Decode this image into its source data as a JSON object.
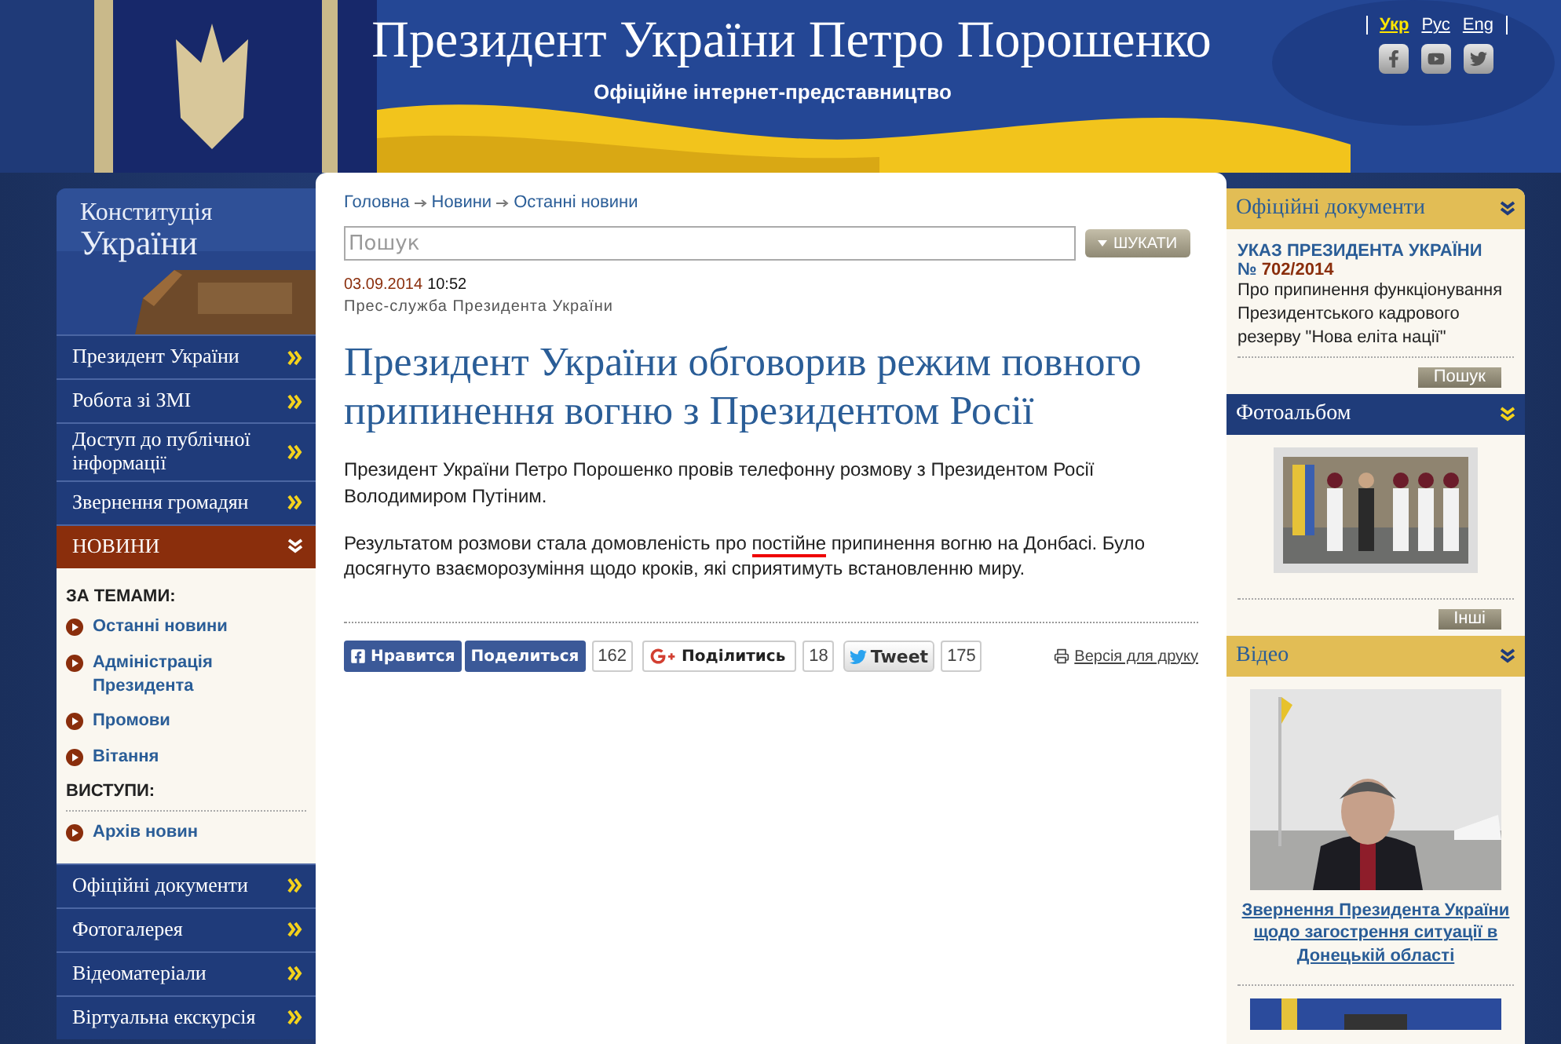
{
  "header": {
    "title": "Президент України Петро Порошенко",
    "subtitle": "Офіційне інтернет-представництво",
    "languages": [
      {
        "label": "Укр",
        "selected": true
      },
      {
        "label": "Рус",
        "selected": false
      },
      {
        "label": "Eng",
        "selected": false
      }
    ]
  },
  "sidebar": {
    "banner": {
      "line1": "Конституція",
      "line2": "України"
    },
    "menu": [
      {
        "label": "Президент України",
        "expanded": false
      },
      {
        "label": "Робота зі ЗМІ",
        "expanded": false
      },
      {
        "label": "Доступ до публічної інформації",
        "expanded": false
      },
      {
        "label": "Звернення громадян",
        "expanded": false
      },
      {
        "label": "НОВИНИ",
        "expanded": true,
        "groups": [
          {
            "heading": "ЗА ТЕМАМИ:",
            "links": [
              "Останні новини",
              "Адміністрація Президента",
              "Промови",
              "Вітання"
            ]
          },
          {
            "heading": "ВИСТУПИ:",
            "links": [
              "Архів новин"
            ]
          }
        ]
      },
      {
        "label": "Офіційні документи",
        "expanded": false
      },
      {
        "label": "Фотогалерея",
        "expanded": false
      },
      {
        "label": "Відеоматеріали",
        "expanded": false
      },
      {
        "label": "Віртуальна екскурсія",
        "expanded": false
      }
    ]
  },
  "breadcrumbs": [
    "Головна",
    "Новини",
    "Останні новини"
  ],
  "search": {
    "placeholder": "Пошук",
    "button": "ШУКАТИ"
  },
  "article": {
    "date": "03.09.2014",
    "time": "10:52",
    "source": "Прес-служба Президента України",
    "title": "Президент України обговорив режим повного припинення вогню з Президентом Росії",
    "paragraphs": [
      [
        {
          "text": "Президент України Петро Порошенко провів телефонну розмову з Президентом Росії Володимиром Путіним.",
          "underlined": false
        }
      ],
      [
        {
          "text": "Результатом розмови стала домовленість про ",
          "underlined": false
        },
        {
          "text": "постійне",
          "underlined": true
        },
        {
          "text": " припинення вогню на Донбасі. Було досягнуто взаєморозуміння щодо кроків, які сприятимуть встановленню миру.",
          "underlined": false
        }
      ]
    ]
  },
  "share": [
    {
      "kind": "facebook",
      "buttons": [
        "Нравится",
        "Поделиться"
      ],
      "count": "162"
    },
    {
      "kind": "google",
      "buttons": [
        "Поділитись"
      ],
      "count": "18"
    },
    {
      "kind": "twitter",
      "buttons": [
        "Tweet"
      ],
      "count": "175"
    }
  ],
  "print_link": "Версія для друку",
  "right_panels": [
    {
      "title": "Офіційні документи",
      "color": "#e2bd55",
      "kind": "document",
      "doc_title": "УКАЗ ПРЕЗИДЕНТА УКРАЇНИ",
      "doc_number_prefix": "№",
      "doc_number": "702/2014",
      "doc_text": "Про припинення функціонування Президентського кадрового резерву \"Нова еліта нації\"",
      "button": "Пошук"
    },
    {
      "title": "Фотоальбом",
      "color": "#1f3c7a",
      "button": "Інші"
    },
    {
      "title": "Відео",
      "color": "#e2bd55",
      "kind": "video",
      "caption": "Звернення Президента України щодо загострення ситуації в Донецькій області"
    }
  ]
}
